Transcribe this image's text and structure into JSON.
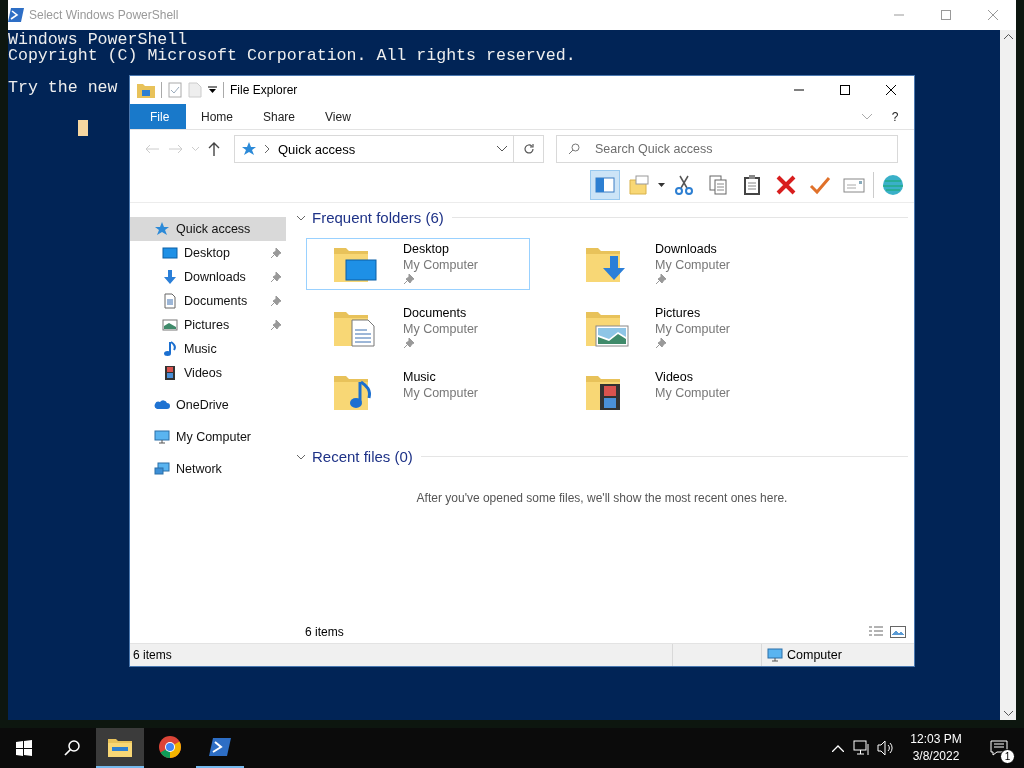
{
  "powershell": {
    "title": "Select Windows PowerShell",
    "lines": [
      "Windows PowerShell",
      "Copyright (C) Microsoft Corporation. All rights reserved."
    ],
    "prompt_line": "Try the new"
  },
  "explorer": {
    "title": "File Explorer",
    "file_menu": "File",
    "ribbon_tabs": [
      "Home",
      "Share",
      "View"
    ],
    "help_glyph": "?",
    "address": "Quick access",
    "search": {
      "placeholder": "Search Quick access"
    },
    "toolbar_buttons": [
      {
        "pressed": true
      },
      {
        "pressed": false
      },
      {
        "pressed": false
      },
      {
        "pressed": false
      },
      {
        "pressed": false
      },
      {
        "pressed": false
      },
      {
        "pressed": false
      },
      {
        "pressed": false
      },
      {
        "pressed": false
      }
    ],
    "sidebar": {
      "items": [
        {
          "label": "Quick access",
          "selected": true,
          "children": [
            {
              "label": "Desktop",
              "selected": false,
              "pinned": true
            },
            {
              "label": "Downloads",
              "selected": false,
              "pinned": true
            },
            {
              "label": "Documents",
              "selected": false,
              "pinned": true
            },
            {
              "label": "Pictures",
              "selected": false,
              "pinned": true
            },
            {
              "label": "Music",
              "selected": false,
              "pinned": false
            },
            {
              "label": "Videos",
              "selected": false,
              "pinned": false
            }
          ]
        },
        {
          "label": "OneDrive",
          "selected": false
        },
        {
          "label": "My Computer",
          "selected": false
        },
        {
          "label": "Network",
          "selected": false
        }
      ]
    },
    "frequent_folders": {
      "title": "Frequent folders (6)",
      "expanded": true,
      "items": [
        {
          "name": "Desktop",
          "location": "My Computer",
          "pinned": true,
          "selected": true
        },
        {
          "name": "Downloads",
          "location": "My Computer",
          "pinned": true,
          "selected": false
        },
        {
          "name": "Documents",
          "location": "My Computer",
          "pinned": true,
          "selected": false
        },
        {
          "name": "Pictures",
          "location": "My Computer",
          "pinned": true,
          "selected": false
        },
        {
          "name": "Music",
          "location": "My Computer",
          "pinned": false,
          "selected": false
        },
        {
          "name": "Videos",
          "location": "My Computer",
          "pinned": false,
          "selected": false
        }
      ]
    },
    "recent_files": {
      "title": "Recent files (0)",
      "expanded": true,
      "empty_message": "After you've opened some files, we'll show the most recent ones here."
    },
    "item_count": "6 items",
    "status_bar": {
      "left": "6 items",
      "location": "Computer"
    }
  },
  "taskbar": {
    "apps": [
      {
        "active": true,
        "running": true
      },
      {
        "active": false,
        "running": false
      },
      {
        "active": false,
        "running": true
      }
    ],
    "time": "12:03 PM",
    "date": "3/8/2022",
    "notification_count": "1"
  }
}
